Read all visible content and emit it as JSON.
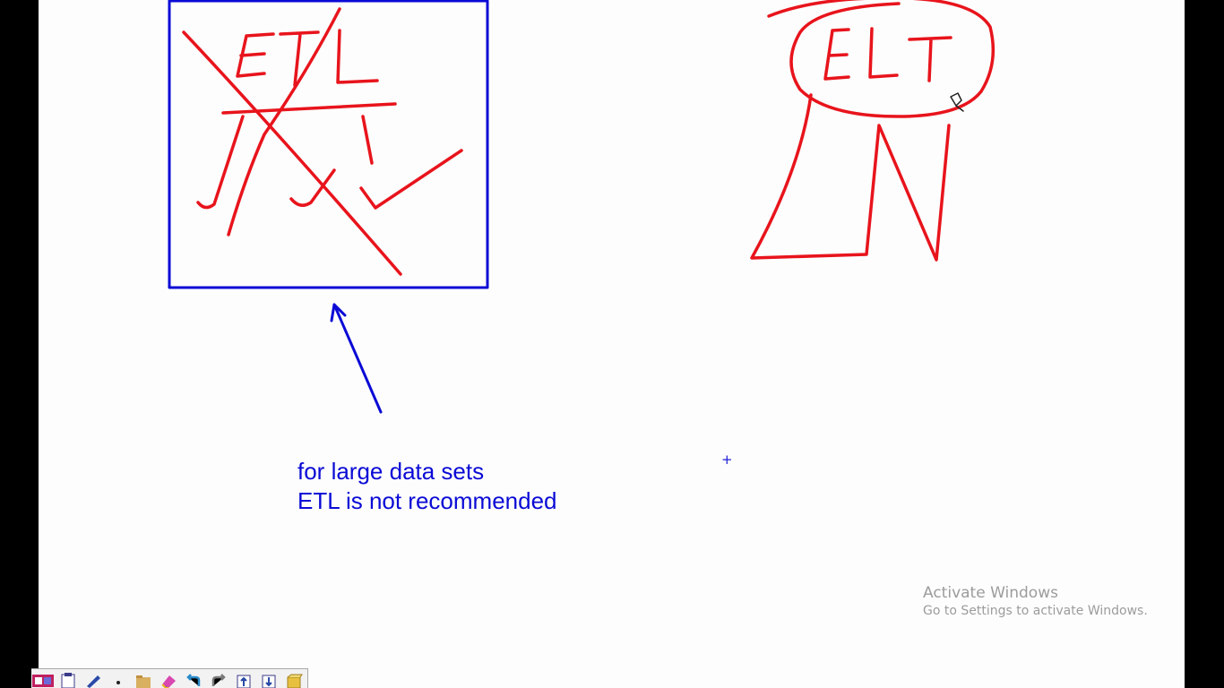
{
  "annotation": {
    "line1": "for large data sets",
    "line2": "ETL is not recommended",
    "color": "#0a0ad6"
  },
  "drawing": {
    "left_label": "ETL",
    "right_label": "ELT",
    "ink_red": "#e8141c",
    "ink_blue": "#0a0ad6"
  },
  "watermark": {
    "title": "Activate Windows",
    "subtitle": "Go to Settings to activate Windows."
  },
  "crosshair_glyph": "+",
  "toolbar": {
    "tools": [
      {
        "name": "pen-colors-icon"
      },
      {
        "name": "clipboard-icon"
      },
      {
        "name": "pen-icon"
      },
      {
        "name": "dot-icon"
      },
      {
        "name": "folder-icon"
      },
      {
        "name": "eraser-icon"
      },
      {
        "name": "undo-icon"
      },
      {
        "name": "redo-icon"
      },
      {
        "name": "upload-icon"
      },
      {
        "name": "download-icon"
      },
      {
        "name": "package-icon"
      }
    ]
  }
}
